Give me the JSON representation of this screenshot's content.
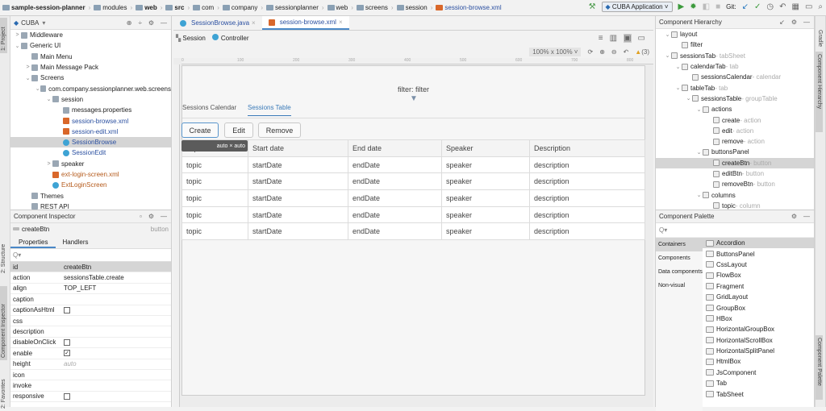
{
  "breadcrumb": [
    "sample-session-planner",
    "modules",
    "web",
    "src",
    "com",
    "company",
    "sessionplanner",
    "web",
    "screens",
    "session",
    "session-browse.xml"
  ],
  "toolbar": {
    "run_config": "CUBA Application",
    "git_label": "Git:"
  },
  "project": {
    "selector": "CUBA",
    "side_tab": "1: Project",
    "tree": [
      {
        "label": "Middleware",
        "depth": 0,
        "arrow": ">"
      },
      {
        "label": "Generic UI",
        "depth": 0,
        "arrow": "v"
      },
      {
        "label": "Main Menu",
        "depth": 1,
        "arrow": ""
      },
      {
        "label": "Main Message Pack",
        "depth": 1,
        "arrow": ">"
      },
      {
        "label": "Screens",
        "depth": 1,
        "arrow": "v"
      },
      {
        "label": "com.company.sessionplanner.web.screens",
        "depth": 2,
        "arrow": "v"
      },
      {
        "label": "session",
        "depth": 3,
        "arrow": "v"
      },
      {
        "label": "messages.properties",
        "depth": 4,
        "arrow": ""
      },
      {
        "label": "session-browse.xml",
        "depth": 4,
        "arrow": ""
      },
      {
        "label": "session-edit.xml",
        "depth": 4,
        "arrow": ""
      },
      {
        "label": "SessionBrowse",
        "depth": 4,
        "arrow": ""
      },
      {
        "label": "SessionEdit",
        "depth": 4,
        "arrow": ""
      },
      {
        "label": "speaker",
        "depth": 3,
        "arrow": ">"
      },
      {
        "label": "ext-login-screen.xml",
        "depth": 3,
        "arrow": ""
      },
      {
        "label": "ExtLoginScreen",
        "depth": 3,
        "arrow": ""
      },
      {
        "label": "Themes",
        "depth": 1,
        "arrow": ""
      },
      {
        "label": "REST API",
        "depth": 1,
        "arrow": ""
      }
    ]
  },
  "inspector": {
    "title": "Component Inspector",
    "component": "createBtn",
    "type": "button",
    "tabs": [
      "Properties",
      "Handlers"
    ],
    "props": [
      {
        "k": "id",
        "v": "createBtn"
      },
      {
        "k": "action",
        "v": "sessionsTable.create"
      },
      {
        "k": "align",
        "v": "TOP_LEFT"
      },
      {
        "k": "caption",
        "v": ""
      },
      {
        "k": "captionAsHtml",
        "v": "[ ]"
      },
      {
        "k": "css",
        "v": ""
      },
      {
        "k": "description",
        "v": ""
      },
      {
        "k": "disableOnClick",
        "v": "[ ]"
      },
      {
        "k": "enable",
        "v": "[x]"
      },
      {
        "k": "height",
        "v": "auto"
      },
      {
        "k": "icon",
        "v": ""
      },
      {
        "k": "invoke",
        "v": ""
      },
      {
        "k": "responsive",
        "v": "[ ]"
      }
    ]
  },
  "side_tabs": {
    "structure": "2: Structure",
    "inspector": "Component Inspector",
    "favorites": "2: Favorites",
    "gradle": "Gradle",
    "hierarchy": "Component Hierarchy",
    "palette": "Component Palette"
  },
  "editor": {
    "tabs": [
      "SessionBrowse.java",
      "session-browse.xml"
    ],
    "subtabs": [
      "Session",
      "Controller"
    ],
    "zoom": "100% x 100%",
    "warnings": "(3)",
    "ruler": [
      "0",
      "100",
      "200",
      "300",
      "400",
      "500",
      "600",
      "700",
      "800"
    ],
    "filter_label": "filter: filter",
    "canvas_tabs": [
      "Sessions Calendar",
      "Sessions Table"
    ],
    "buttons": [
      "Create",
      "Edit",
      "Remove"
    ],
    "size_badge": "auto × auto",
    "columns": [
      "Topic",
      "Start date",
      "End date",
      "Speaker",
      "Description"
    ],
    "rows": [
      [
        "topic",
        "startDate",
        "endDate",
        "speaker",
        "description"
      ],
      [
        "topic",
        "startDate",
        "endDate",
        "speaker",
        "description"
      ],
      [
        "topic",
        "startDate",
        "endDate",
        "speaker",
        "description"
      ],
      [
        "topic",
        "startDate",
        "endDate",
        "speaker",
        "description"
      ],
      [
        "topic",
        "startDate",
        "endDate",
        "speaker",
        "description"
      ]
    ]
  },
  "hierarchy": {
    "title": "Component Hierarchy",
    "items": [
      {
        "n": "layout",
        "t": "",
        "d": 0,
        "a": "v"
      },
      {
        "n": "filter",
        "t": "",
        "d": 1,
        "a": ""
      },
      {
        "n": "sessionsTab",
        "t": " - tabSheet",
        "d": 0,
        "a": "v"
      },
      {
        "n": "calendarTab",
        "t": " - tab",
        "d": 1,
        "a": "v"
      },
      {
        "n": "sessionsCalendar",
        "t": " - calendar",
        "d": 2,
        "a": ""
      },
      {
        "n": "tableTab",
        "t": " - tab",
        "d": 1,
        "a": "v"
      },
      {
        "n": "sessionsTable",
        "t": " - groupTable",
        "d": 2,
        "a": "v"
      },
      {
        "n": "actions",
        "t": "",
        "d": 3,
        "a": "v"
      },
      {
        "n": "create",
        "t": " - action",
        "d": 4,
        "a": ""
      },
      {
        "n": "edit",
        "t": " - action",
        "d": 4,
        "a": ""
      },
      {
        "n": "remove",
        "t": " - action",
        "d": 4,
        "a": ""
      },
      {
        "n": "buttonsPanel",
        "t": "",
        "d": 3,
        "a": "v"
      },
      {
        "n": "createBtn",
        "t": " - button",
        "d": 4,
        "a": ""
      },
      {
        "n": "editBtn",
        "t": " - button",
        "d": 4,
        "a": ""
      },
      {
        "n": "removeBtn",
        "t": " - button",
        "d": 4,
        "a": ""
      },
      {
        "n": "columns",
        "t": "",
        "d": 3,
        "a": "v"
      },
      {
        "n": "topic",
        "t": " - column",
        "d": 4,
        "a": ""
      }
    ]
  },
  "palette": {
    "title": "Component Palette",
    "categories": [
      "Containers",
      "Components",
      "Data components",
      "Non-visual"
    ],
    "items": [
      "Accordion",
      "ButtonsPanel",
      "CssLayout",
      "FlowBox",
      "Fragment",
      "GridLayout",
      "GroupBox",
      "HBox",
      "HorizontalGroupBox",
      "HorizontalScrollBox",
      "HorizontalSplitPanel",
      "HtmlBox",
      "JsComponent",
      "Tab",
      "TabSheet"
    ]
  }
}
